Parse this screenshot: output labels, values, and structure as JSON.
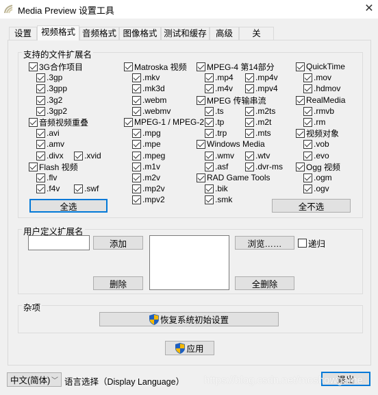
{
  "window": {
    "title": "Media Preview 设置工具",
    "close_icon": "close-icon",
    "app_icon": "media-preview-icon"
  },
  "tabs": [
    {
      "label": "设置",
      "active": false
    },
    {
      "label": "视频格式",
      "active": true
    },
    {
      "label": "音频格式",
      "active": false
    },
    {
      "label": "图像格式",
      "active": false
    },
    {
      "label": "测试和缓存",
      "active": false
    },
    {
      "label": "高级",
      "active": false
    },
    {
      "label": "关于……",
      "active": false
    }
  ],
  "extensions": {
    "title": "支持的文件扩展名",
    "columns": [
      [
        {
          "label": "3G合作项目",
          "checked": true,
          "rows": [
            [
              ".3gp"
            ],
            [
              ".3gpp"
            ],
            [
              ".3g2"
            ],
            [
              ".3gp2"
            ]
          ]
        },
        {
          "label": "音频视频重叠",
          "checked": true,
          "rows": [
            [
              ".avi"
            ],
            [
              ".amv"
            ],
            [
              ".divx",
              ".xvid"
            ]
          ]
        },
        {
          "label": "Flash 视频",
          "checked": true,
          "rows": [
            [
              ".flv"
            ],
            [
              ".f4v",
              ".swf"
            ]
          ]
        }
      ],
      [
        {
          "label": "Matroska 视频",
          "checked": true,
          "rows": [
            [
              ".mkv"
            ],
            [
              ".mk3d"
            ],
            [
              ".webm"
            ],
            [
              ".webmv"
            ]
          ]
        },
        {
          "label": "MPEG-1 / MPEG-2",
          "checked": true,
          "rows": [
            [
              ".mpg"
            ],
            [
              ".mpe"
            ],
            [
              ".mpeg"
            ],
            [
              ".m1v"
            ],
            [
              ".m2v"
            ],
            [
              ".mp2v"
            ],
            [
              ".mpv2"
            ]
          ]
        }
      ],
      [
        {
          "label": "MPEG-4 第14部分",
          "checked": true,
          "rows": [
            [
              ".mp4",
              ".mp4v"
            ],
            [
              ".m4v",
              ".mpv4"
            ]
          ]
        },
        {
          "label": "MPEG 传输串流",
          "checked": true,
          "rows": [
            [
              ".ts",
              ".m2ts"
            ],
            [
              ".tp",
              ".m2t"
            ],
            [
              ".trp",
              ".mts"
            ]
          ]
        },
        {
          "label": "Windows Media",
          "checked": true,
          "rows": [
            [
              ".wmv",
              ".wtv"
            ],
            [
              ".asf",
              ".dvr-ms"
            ]
          ]
        },
        {
          "label": "RAD Game Tools",
          "checked": true,
          "rows": [
            [
              ".bik"
            ],
            [
              ".smk"
            ]
          ]
        }
      ],
      [
        {
          "label": "QuickTime",
          "checked": true,
          "rows": [
            [
              ".mov"
            ],
            [
              ".hdmov"
            ]
          ]
        },
        {
          "label": "RealMedia",
          "checked": true,
          "rows": [
            [
              ".rmvb"
            ],
            [
              ".rm"
            ]
          ]
        },
        {
          "label": "视频对象",
          "checked": true,
          "rows": [
            [
              ".vob"
            ],
            [
              ".evo"
            ]
          ]
        },
        {
          "label": "Ogg 视频",
          "checked": true,
          "rows": [
            [
              ".ogm"
            ],
            [
              ".ogv"
            ]
          ]
        }
      ]
    ],
    "select_all": "全选",
    "select_none": "全不选"
  },
  "custom": {
    "title": "用户定义扩展名",
    "input_value": "",
    "add": "添加",
    "remove": "删除",
    "browse": "浏览……",
    "recursive_label": "递归",
    "recursive_checked": false,
    "remove_all": "全删除"
  },
  "misc": {
    "title": "杂项",
    "restore": "恢复系统初始设置"
  },
  "apply": "应用",
  "footer": {
    "language_value": "中文(简体)",
    "language_label": "语言选择（Display Language）",
    "exit": "退出"
  },
  "watermark": "https://blog.csdn.net/moshowgame",
  "colors": {
    "focus_border": "#0078d7",
    "shield_blue": "#1f5fbf",
    "shield_yellow": "#f5b800"
  }
}
